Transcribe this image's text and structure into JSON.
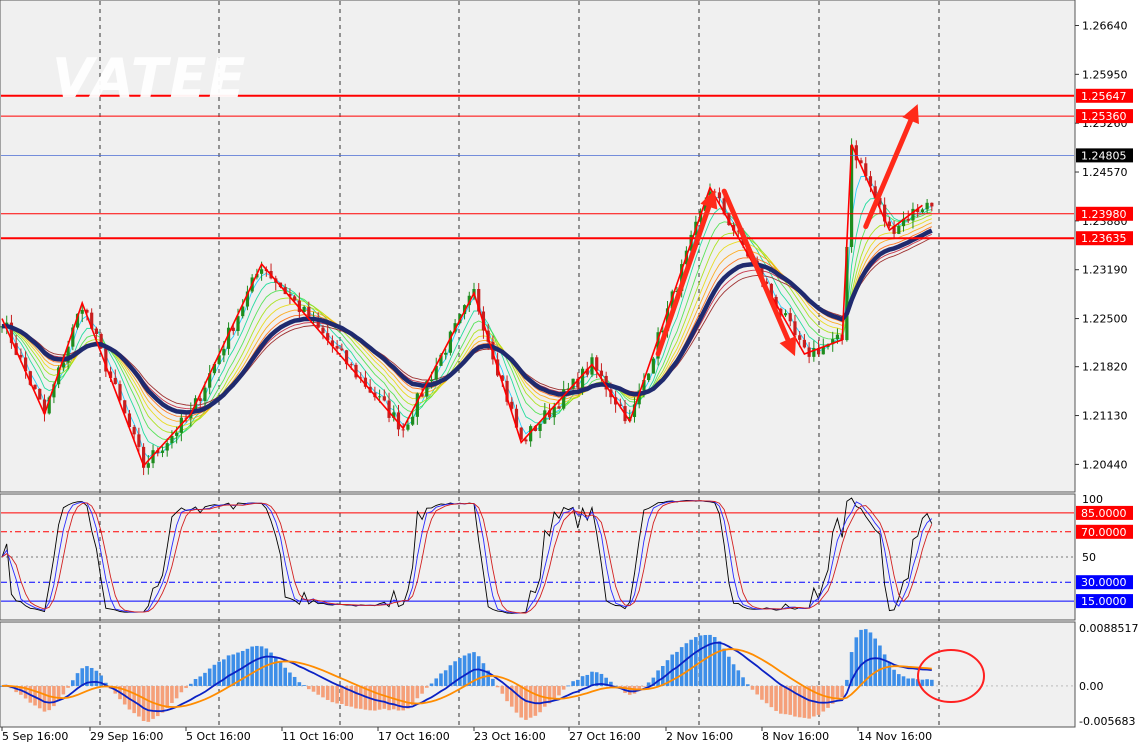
{
  "watermark": "VATEE",
  "colors": {
    "background": "#f0f0f0",
    "candle_up": "#1e8c1e",
    "candle_down": "#c81e1e",
    "ma_thick": "#1f2a6e",
    "support_line": "#ff0000",
    "price_line": "#4a6cd4",
    "stoch_fast": "#000000",
    "stoch_main": "#2a2aff",
    "stoch_signal": "#d22020",
    "macd_pos": "#3d8ee8",
    "macd_neg": "#f5a07a",
    "macd_main": "#0b22c4",
    "macd_signal": "#ff8c00",
    "arrow": "#ff2a1a"
  },
  "chart_data": [
    {
      "type": "candlestick",
      "pane": "price",
      "ylim": [
        1.2005,
        1.27
      ],
      "ticks": [
        "1.26640",
        "1.25950",
        "1.25260",
        "1.24570",
        "1.23880",
        "1.23190",
        "1.22500",
        "1.21820",
        "1.21130",
        "1.20440"
      ],
      "tick_values": [
        1.2664,
        1.2595,
        1.2526,
        1.2457,
        1.2388,
        1.2319,
        1.225,
        1.2182,
        1.2113,
        1.2044
      ],
      "levels": [
        {
          "value": 1.25647,
          "label": "1.25647",
          "weight": "thick"
        },
        {
          "value": 1.2536,
          "label": "1.25360",
          "weight": "thin"
        },
        {
          "value": 1.2398,
          "label": "1.23980",
          "weight": "thin"
        },
        {
          "value": 1.23635,
          "label": "1.23635",
          "weight": "thick"
        }
      ],
      "current_price": {
        "value": 1.24805,
        "label": "1.24805"
      },
      "zigzag": [
        [
          0,
          1.225
        ],
        [
          9,
          1.2115
        ],
        [
          17,
          1.2272
        ],
        [
          30,
          1.2042
        ],
        [
          40,
          1.2115
        ],
        [
          55,
          1.2327
        ],
        [
          85,
          1.2095
        ],
        [
          100,
          1.2286
        ],
        [
          110,
          1.2075
        ],
        [
          125,
          1.2185
        ],
        [
          133,
          1.2105
        ],
        [
          150,
          1.2435
        ],
        [
          170,
          1.22
        ],
        [
          178,
          1.222
        ],
        [
          180,
          1.2496
        ],
        [
          188,
          1.2375
        ],
        [
          195,
          1.241
        ]
      ],
      "arrows": [
        {
          "from": [
            139,
            1.22
          ],
          "to": [
            151,
            1.2432
          ]
        },
        {
          "from": [
            153,
            1.243
          ],
          "to": [
            168,
            1.2197
          ]
        },
        {
          "from": [
            183,
            1.238
          ],
          "to": [
            194,
            1.2553
          ]
        }
      ]
    },
    {
      "type": "line",
      "pane": "stochastic",
      "ylim": [
        0,
        100
      ],
      "ticks": [
        "100",
        "50"
      ],
      "tick_values": [
        100,
        50
      ],
      "levels": [
        {
          "value": 85,
          "label": "85.0000",
          "color": "#ff0000",
          "style": "solid"
        },
        {
          "value": 70,
          "label": "70.0000",
          "color": "#ff0000",
          "style": "dashdot"
        },
        {
          "value": 30,
          "label": "30.0000",
          "color": "#0000ff",
          "style": "dashdot"
        },
        {
          "value": 15,
          "label": "15.0000",
          "color": "#0000ff",
          "style": "solid"
        }
      ]
    },
    {
      "type": "bar",
      "pane": "macd",
      "ylim": [
        -0.005683,
        0.0088517
      ],
      "ticks": [
        "0.0088517",
        "0.00",
        "-0.005683"
      ],
      "tick_values": [
        0.0088517,
        0.0,
        -0.005683
      ]
    }
  ],
  "x_labels": [
    "5 Sep 16:00",
    "29 Sep 16:00",
    "5 Oct 16:00",
    "11 Oct 16:00",
    "17 Oct 16:00",
    "23 Oct 16:00",
    "27 Oct 16:00",
    "2 Nov 16:00",
    "8 Nov 16:00",
    "14 Nov 16:00"
  ],
  "x_label_positions": [
    0,
    20,
    45,
    70,
    95,
    120,
    145,
    170,
    195,
    220
  ]
}
